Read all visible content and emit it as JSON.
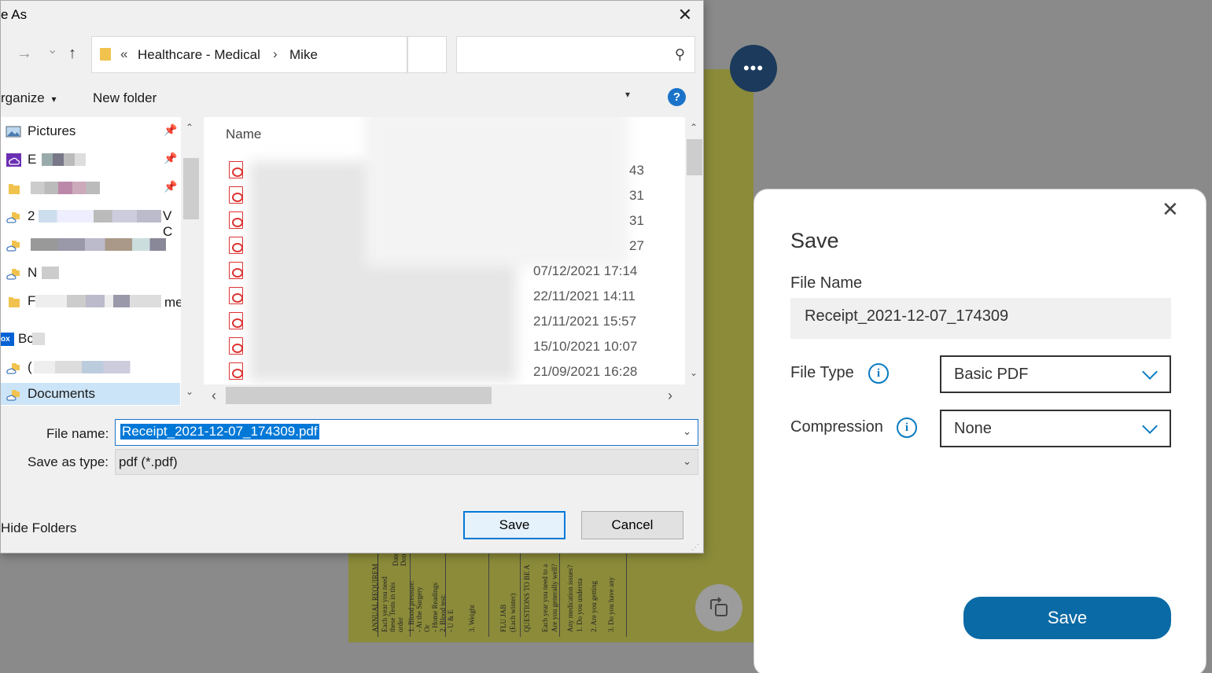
{
  "dialog": {
    "title": "e As",
    "close_glyph": "✕",
    "nav": {
      "forward_glyph": "→",
      "down_glyph": "⌄",
      "up_glyph": "↑"
    },
    "address": {
      "prefix": "«",
      "segment1": "Healthcare - Medical",
      "separator": "›",
      "segment2": "Mike"
    },
    "search": {
      "icon": "search-icon",
      "glyph": "⚲"
    },
    "toolbar": {
      "organize": "rganize",
      "organize_arrow": "▾",
      "new_folder": "New folder",
      "help_glyph": "?",
      "view_arrow": "▾"
    },
    "nav_items": [
      {
        "label": "Pictures",
        "icon": "pictures-icon",
        "pinned": true
      },
      {
        "label": "E",
        "icon": "onedrive-purple-icon",
        "pinned": true
      },
      {
        "label": "",
        "icon": "folder-icon",
        "pinned": true
      },
      {
        "label": "2",
        "suffix": "V C",
        "icon": "onedrive-folder-icon",
        "pinned": false
      },
      {
        "label": "",
        "icon": "onedrive-folder-icon",
        "pinned": false
      },
      {
        "label": "N",
        "icon": "onedrive-folder-icon",
        "pinned": false
      },
      {
        "label": "F",
        "suffix": "me",
        "icon": "folder-icon",
        "pinned": false
      },
      {
        "label": "Bc",
        "prefix": "ox",
        "icon": "box-icon",
        "pinned": false
      },
      {
        "label": "(",
        "icon": "onedrive-folder-icon",
        "pinned": false
      },
      {
        "label": "Documents",
        "icon": "documents-icon",
        "pinned": false,
        "selected": true
      }
    ],
    "pin_glyph": "📌",
    "list": {
      "column_name": "Name",
      "dates": [
        "43",
        "31",
        "31",
        "27",
        "07/12/2021 17:14",
        "22/11/2021 14:11",
        "21/11/2021 15:57",
        "15/10/2021 10:07",
        "21/09/2021 16:28"
      ]
    },
    "scroll": {
      "up": "⌃",
      "down": "⌄",
      "left": "‹",
      "right": "›"
    },
    "file_name_label": "File name:",
    "file_name_value": "Receipt_2021-12-07_174309.pdf",
    "save_type_label": "Save as type:",
    "save_type_value": "pdf (*.pdf)",
    "dropdown_glyph": "⌄",
    "hide_folders": "Hide Folders",
    "hide_folders_arrow": "",
    "save_button": "Save",
    "cancel_button": "Cancel",
    "grip_glyph": "⋰"
  },
  "background": {
    "more_glyph": "•••",
    "rotate_glyph": "⟳",
    "scan_lines": [
      "ANNUAL REQUIREM",
      "Each year you need",
      "these Tests in this",
      "order",
      "1. Blood pressure:",
      "- At the Surgery",
      "Or",
      "- Home Readings",
      "2. Blood test:",
      "- U & E",
      "3. Weight",
      "FLU JAB",
      "(Each winter)",
      "QUESTIONS TO BE A",
      "Each year you need to a",
      "Are you generally well?",
      "Any medication issues?",
      "1. Do you understa",
      "2. Are you getting",
      "3. Do you have any",
      "Date",
      "Done"
    ]
  },
  "hp_panel": {
    "close_glyph": "✕",
    "title": "Save",
    "file_name_label": "File Name",
    "file_name_value": "Receipt_2021-12-07_174309",
    "file_type_label": "File Type",
    "file_type_value": "Basic PDF",
    "compression_label": "Compression",
    "compression_value": "None",
    "info_glyph": "i",
    "save_button": "Save",
    "accent_color": "#0a6aa5"
  }
}
